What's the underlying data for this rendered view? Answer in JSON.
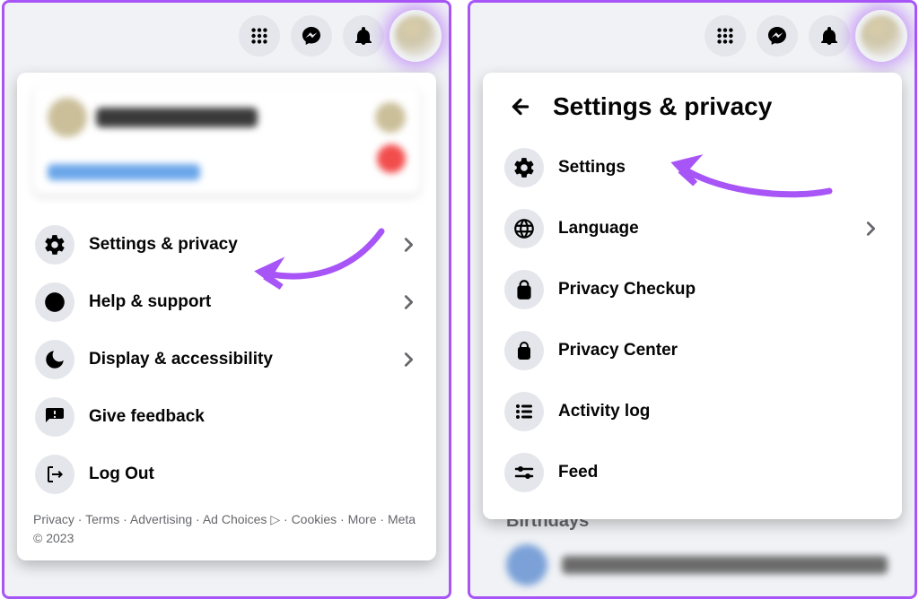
{
  "header_icons": {
    "menu": "menu-dots-icon",
    "messenger": "messenger-icon",
    "notifications": "bell-icon",
    "profile": "avatar"
  },
  "panel1": {
    "menu": [
      {
        "label": "Settings & privacy",
        "icon": "gear-icon",
        "has_chevron": true
      },
      {
        "label": "Help & support",
        "icon": "question-icon",
        "has_chevron": true
      },
      {
        "label": "Display & accessibility",
        "icon": "moon-icon",
        "has_chevron": true
      },
      {
        "label": "Give feedback",
        "icon": "feedback-icon",
        "has_chevron": false
      },
      {
        "label": "Log Out",
        "icon": "logout-icon",
        "has_chevron": false
      }
    ],
    "footer": {
      "links": [
        "Privacy",
        "Terms",
        "Advertising",
        "Ad Choices",
        "Cookies",
        "More"
      ],
      "adchoices_glyph": "▷",
      "copyright": "Meta © 2023"
    }
  },
  "panel2": {
    "title": "Settings & privacy",
    "menu": [
      {
        "label": "Settings",
        "icon": "gear-icon",
        "has_chevron": false
      },
      {
        "label": "Language",
        "icon": "globe-icon",
        "has_chevron": true
      },
      {
        "label": "Privacy Checkup",
        "icon": "heart-lock-icon",
        "has_chevron": false
      },
      {
        "label": "Privacy Center",
        "icon": "lock-icon",
        "has_chevron": false
      },
      {
        "label": "Activity log",
        "icon": "list-icon",
        "has_chevron": false
      },
      {
        "label": "Feed",
        "icon": "sliders-icon",
        "has_chevron": false
      }
    ],
    "behind_label": "Birthdays"
  }
}
